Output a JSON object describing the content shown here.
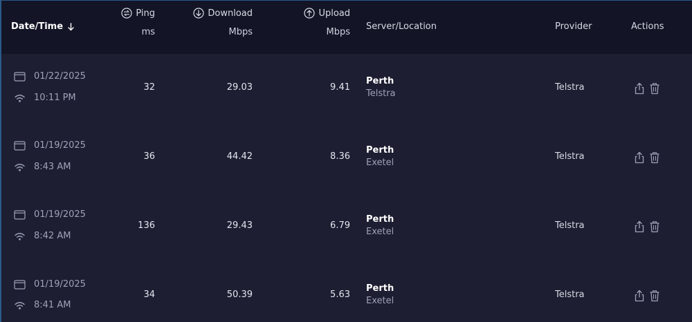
{
  "columns": {
    "datetime": "Date/Time",
    "ping": {
      "label": "Ping",
      "unit": "ms"
    },
    "download": {
      "label": "Download",
      "unit": "Mbps"
    },
    "upload": {
      "label": "Upload",
      "unit": "Mbps"
    },
    "server": "Server/Location",
    "provider": "Provider",
    "actions": "Actions"
  },
  "rows": [
    {
      "date": "01/22/2025",
      "time": "10:11 PM",
      "ping": "32",
      "download": "29.03",
      "upload": "9.41",
      "city": "Perth",
      "isp": "Telstra",
      "provider": "Telstra"
    },
    {
      "date": "01/19/2025",
      "time": "8:43 AM",
      "ping": "36",
      "download": "44.42",
      "upload": "8.36",
      "city": "Perth",
      "isp": "Exetel",
      "provider": "Telstra"
    },
    {
      "date": "01/19/2025",
      "time": "8:42 AM",
      "ping": "136",
      "download": "29.43",
      "upload": "6.79",
      "city": "Perth",
      "isp": "Exetel",
      "provider": "Telstra"
    },
    {
      "date": "01/19/2025",
      "time": "8:41 AM",
      "ping": "34",
      "download": "50.39",
      "upload": "5.63",
      "city": "Perth",
      "isp": "Exetel",
      "provider": "Telstra"
    }
  ],
  "icons": {
    "sort": "arrow-down-icon",
    "ping": "swap-circle-icon",
    "download": "download-circle-icon",
    "upload": "upload-circle-icon",
    "date": "calendar-icon",
    "connection": "wifi-icon",
    "share": "share-icon",
    "delete": "trash-icon"
  },
  "colors": {
    "background": "#1d1e31",
    "header": "#131425",
    "muted_text": "#9fa3b8"
  }
}
